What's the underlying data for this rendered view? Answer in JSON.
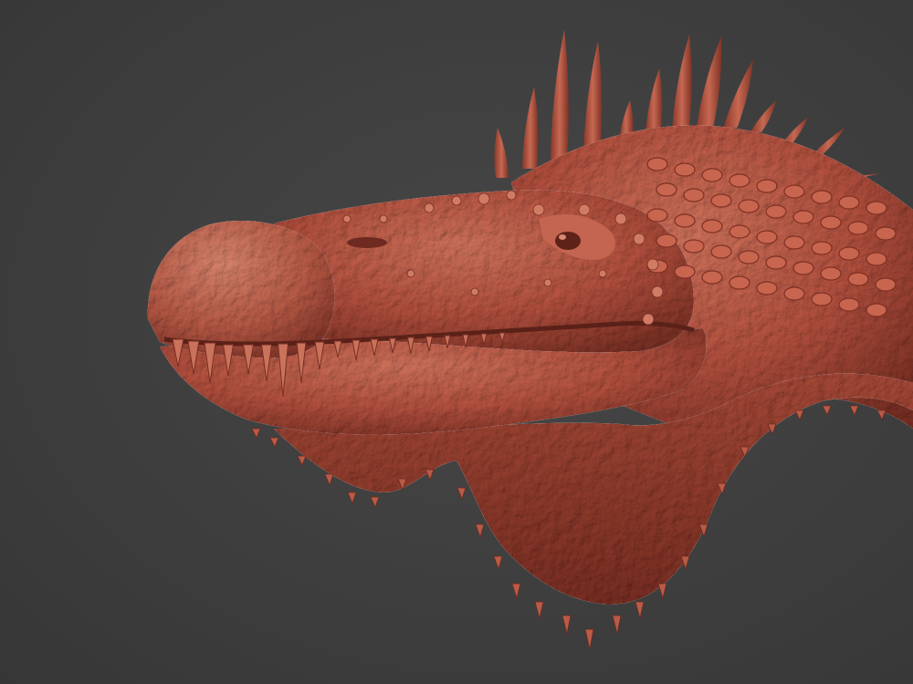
{
  "scene": {
    "subject": "spinosaurus-head-sculpt",
    "background_color": "#3f3f3f",
    "clay_color": "#b5513f",
    "clay_shadow_color": "#6e2a20",
    "clay_highlight_color": "#d97a63"
  }
}
